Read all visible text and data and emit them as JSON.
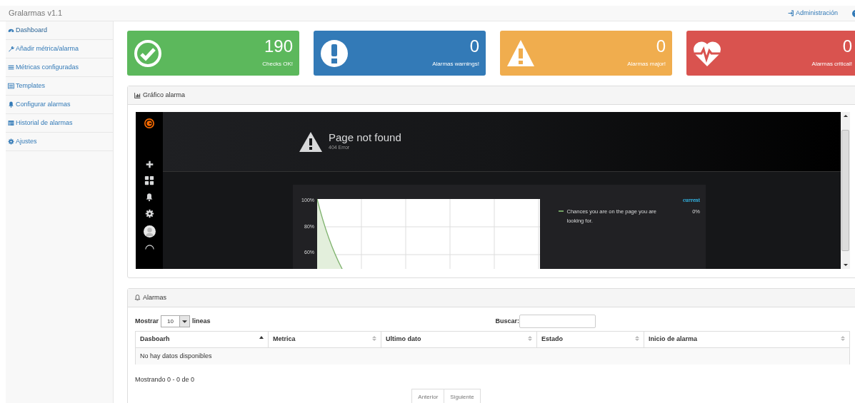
{
  "navbar": {
    "brand": "Gralarmas v1.1",
    "links": [
      {
        "label": "Administración"
      }
    ]
  },
  "sidebar": {
    "items": [
      {
        "label": "Dashboard",
        "selected": true
      },
      {
        "label": "Añadir métrica/alarma",
        "selected": false
      },
      {
        "label": "Métricas configuradas",
        "selected": false
      },
      {
        "label": "Templates",
        "selected": false
      },
      {
        "label": "Configurar alarmas",
        "selected": false
      },
      {
        "label": "Historial de alarmas",
        "selected": false
      },
      {
        "label": "Ajustes",
        "selected": false
      }
    ]
  },
  "stats": [
    {
      "kind": "ok",
      "color": "#5cb85c",
      "value": "190",
      "label": "Checks OK!"
    },
    {
      "kind": "warning",
      "color": "#337ab7",
      "value": "0",
      "label": "Alarmas warnings!"
    },
    {
      "kind": "major",
      "color": "#f0ad4e",
      "value": "0",
      "label": "Alarmas major!"
    },
    {
      "kind": "critical",
      "color": "#d9534f",
      "value": "0",
      "label": "Alarmas critical!"
    }
  ],
  "graph_panel": {
    "title": "Gráfico alarma",
    "embed": {
      "error_title": "Page not found",
      "error_code": "404 Error",
      "y_ticks": [
        "100%",
        "80%",
        "60%"
      ],
      "legend_header": "current",
      "legend_items": [
        {
          "label": "Chances you are on the page you are looking for.",
          "value": "0%"
        }
      ]
    }
  },
  "alarms_panel": {
    "title": "Alarmas",
    "length_label_before": "Mostrar",
    "length_value": "10",
    "length_label_after": "lineas",
    "search_label": "Buscar:",
    "columns": [
      {
        "label": "Dasboarh",
        "sorted": true
      },
      {
        "label": "Metrica",
        "sorted": false
      },
      {
        "label": "Ultimo dato",
        "sorted": false
      },
      {
        "label": "Estado",
        "sorted": false
      },
      {
        "label": "Inicio de alarma",
        "sorted": false
      }
    ],
    "empty_message": "No hay datos disponibles",
    "info": "Mostrando 0 - 0 de 0",
    "pager": [
      {
        "label": "Anterior",
        "disabled": true
      },
      {
        "label": "Siguiente",
        "disabled": true
      }
    ]
  }
}
